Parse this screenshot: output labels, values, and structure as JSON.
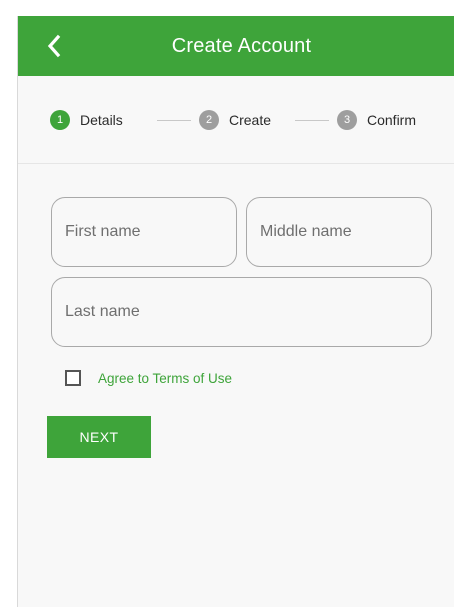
{
  "header": {
    "title": "Create Account",
    "back_icon": "chevron-left-icon"
  },
  "stepper": {
    "steps": [
      {
        "number": "1",
        "label": "Details",
        "state": "active"
      },
      {
        "number": "2",
        "label": "Create",
        "state": "inactive"
      },
      {
        "number": "3",
        "label": "Confirm",
        "state": "inactive"
      }
    ]
  },
  "form": {
    "first_name": {
      "value": "",
      "placeholder": "First name"
    },
    "middle_name": {
      "value": "",
      "placeholder": "Middle name"
    },
    "last_name": {
      "value": "",
      "placeholder": "Last name"
    },
    "terms": {
      "label": "Agree to Terms of Use",
      "checked": false
    },
    "next_label": "NEXT"
  },
  "colors": {
    "primary": "#3ea43a",
    "inactive_step": "#9e9e9e",
    "background": "#f8f8f8"
  }
}
